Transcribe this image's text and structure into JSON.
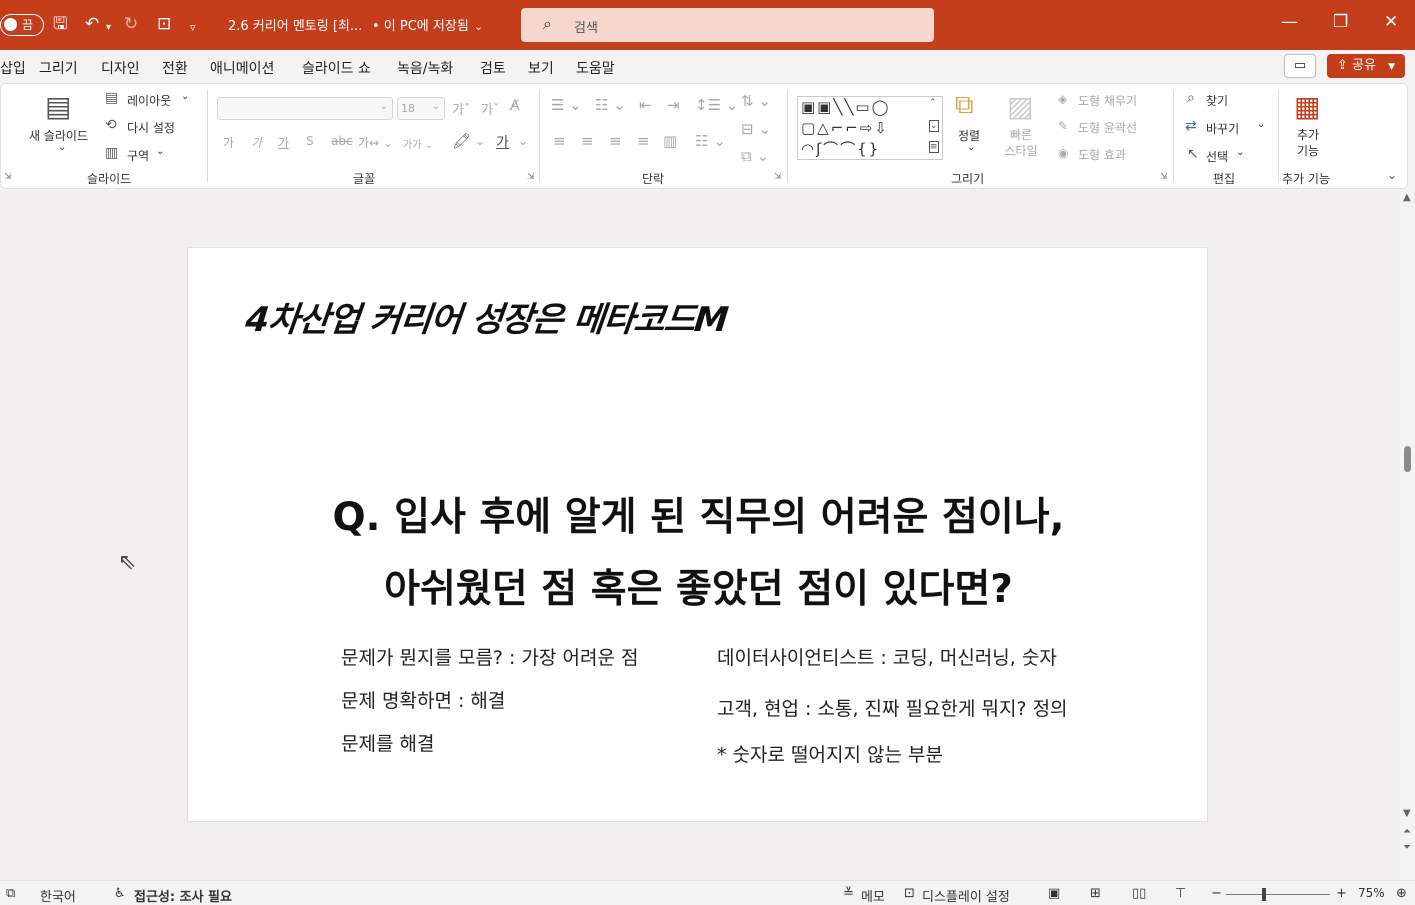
{
  "titlebar": {
    "autosave_label": "끔",
    "doc_title": "2.6 커리어 멘토링 [최...",
    "save_state": "• 이 PC에 저장됨",
    "search_placeholder": "검색",
    "icons": [
      "save-icon",
      "undo-icon",
      "redo-icon",
      "present-icon",
      "customize-qat-icon",
      "minimize-icon",
      "restore-icon",
      "close-icon"
    ]
  },
  "menu": {
    "tabs": [
      "삽입",
      "그리기",
      "디자인",
      "전환",
      "애니메이션",
      "슬라이드 쇼",
      "녹음/녹화",
      "검토",
      "보기",
      "도움말"
    ],
    "visible_first": "삽입",
    "share_label": "공유"
  },
  "ribbon": {
    "slides": {
      "new_slide": "새 슬라이드",
      "layout": "레이아웃",
      "reset": "다시 설정",
      "section": "구역",
      "group": "슬라이드"
    },
    "font": {
      "font_name": "",
      "font_size": "18",
      "group": "글꼴"
    },
    "paragraph": {
      "group": "단락"
    },
    "drawing": {
      "arrange": "정렬",
      "quick_styles": "빠른\n스타일",
      "shape_fill": "도형 채우기",
      "shape_outline": "도형 윤곽선",
      "shape_effects": "도형 효과",
      "group": "그리기"
    },
    "editing": {
      "find": "찾기",
      "replace": "바꾸기",
      "select": "선택",
      "group": "편집"
    },
    "addins": {
      "label": "추가\n기능",
      "group": "추가 기능"
    }
  },
  "slide": {
    "title": "4차산업 커리어 성장은 메타코드M",
    "question_line1": "Q. 입사 후에 알게 된 직무의 어려운 점이나,",
    "question_line2": "아쉬웠던 점 혹은 좋았던 점이 있다면?",
    "left_col": [
      "문제가 뭔지를 모름? : 가장 어려운 점",
      "문제 명확하면 : 해결",
      "문제를 해결"
    ],
    "right_col": [
      "데이터사이언티스트 : 코딩, 머신러닝, 숫자",
      "고객, 현업 : 소통, 진짜 필요한게 뭐지? 정의",
      "* 숫자로 떨어지지 않는 부분"
    ]
  },
  "statusbar": {
    "language": "한국어",
    "accessibility": "접근성: 조사 필요",
    "notes": "메모",
    "display_settings": "디스플레이 설정",
    "zoom": "75%"
  }
}
